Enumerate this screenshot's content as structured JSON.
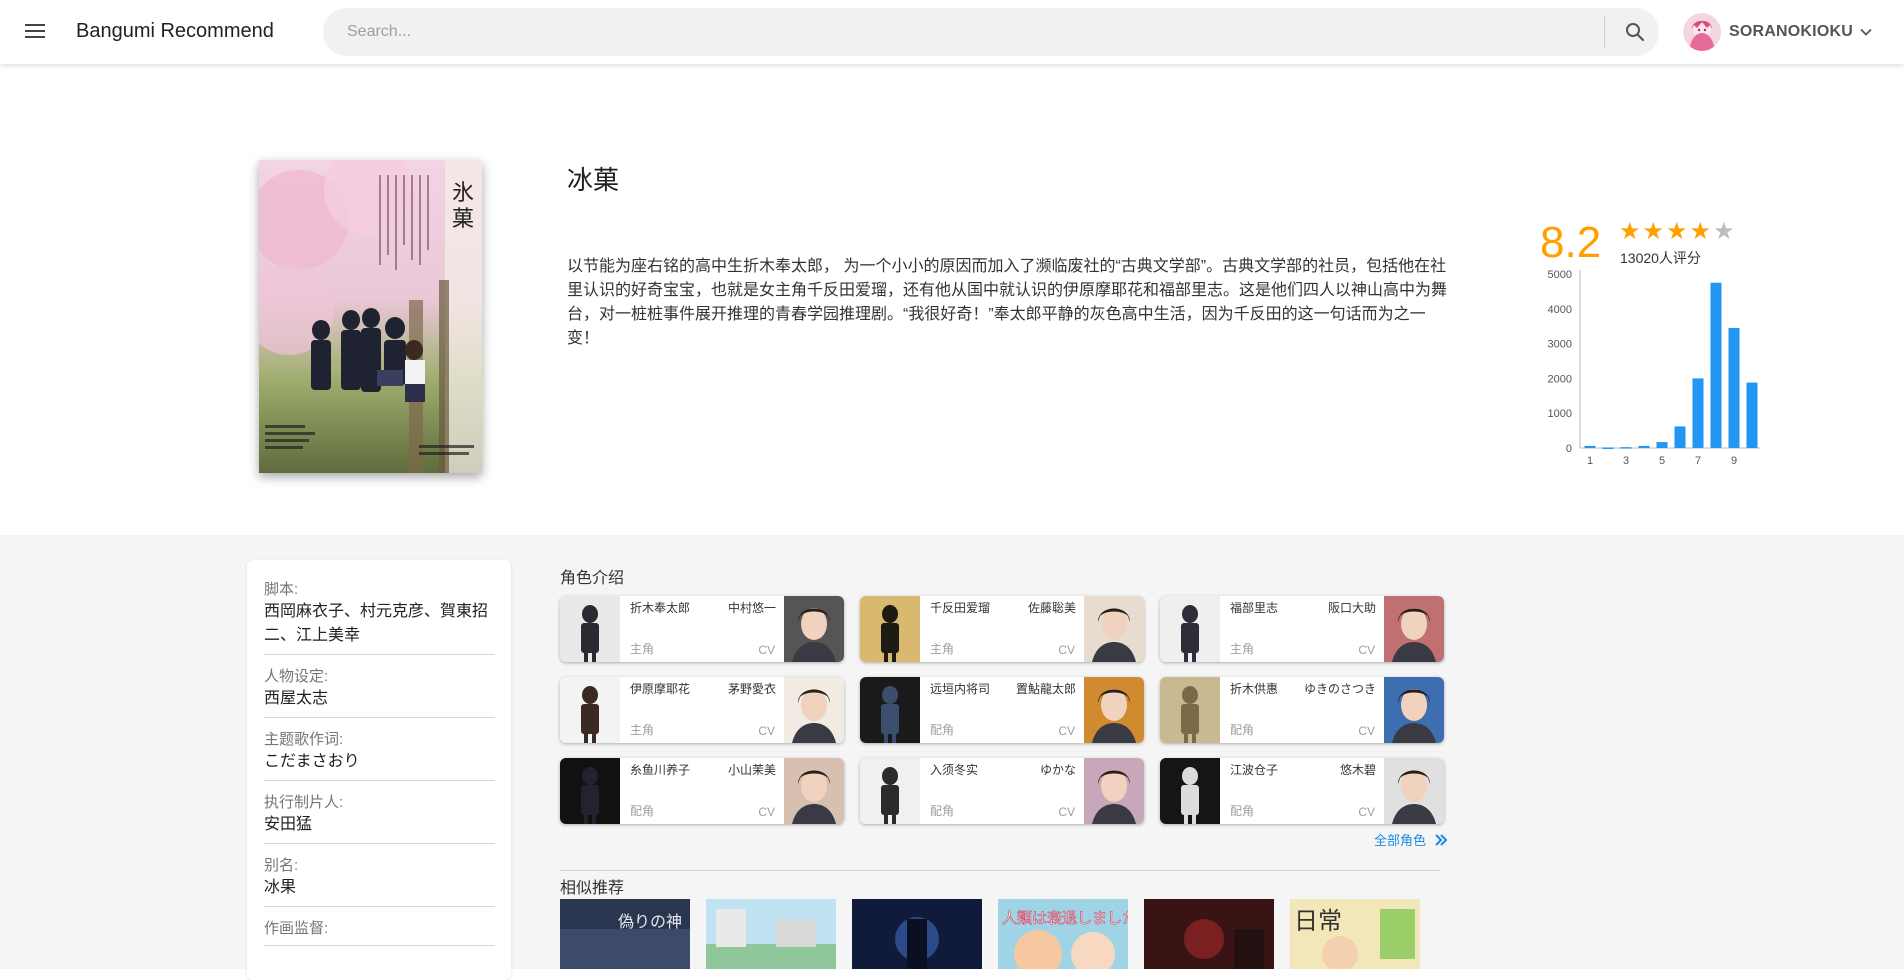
{
  "app": {
    "title": "Bangumi Recommend"
  },
  "search": {
    "placeholder": "Search..."
  },
  "user": {
    "name": "SORANOKIOKU"
  },
  "anime": {
    "title": "冰菓",
    "summary": "以节能为座右铭的高中生折木奉太郎， 为一个小小的原因而加入了濒临废社的“古典文学部”。古典文学部的社员，包括他在社里认识的好奇宝宝，也就是女主角千反田爱瑠，还有他从国中就认识的伊原摩耶花和福部里志。这是他们四人以神山高中为舞台，对一桩桩事件展开推理的青春学园推理剧。“我很好奇！”奉太郎平静的灰色高中生活，因为千反田的这一句话而为之一变！",
    "poster_text": [
      "氷",
      "菓"
    ]
  },
  "rating": {
    "score": "8.2",
    "stars": [
      "★",
      "★",
      "★",
      "★",
      "★"
    ],
    "stars_filled": 4,
    "votes": "13020人评分"
  },
  "chart_data": {
    "type": "bar",
    "categories": [
      1,
      2,
      3,
      4,
      5,
      6,
      7,
      8,
      9,
      10
    ],
    "x_tick_labels": [
      "1",
      "3",
      "5",
      "7",
      "9"
    ],
    "values": [
      60,
      15,
      25,
      60,
      170,
      620,
      2000,
      4750,
      3450,
      1880
    ],
    "y_tick_labels": [
      "5000",
      "4000",
      "3000",
      "2000",
      "1000",
      "0"
    ],
    "ylim": [
      0,
      5000
    ],
    "grid": false,
    "color": "#2196f3"
  },
  "info": [
    {
      "label": "脚本:",
      "value": "西岡麻衣子、村元克彦、賀東招二、江上美幸"
    },
    {
      "label": "人物设定:",
      "value": "西屋太志"
    },
    {
      "label": "主题歌作词:",
      "value": "こだまさおり"
    },
    {
      "label": "执行制片人:",
      "value": "安田猛"
    },
    {
      "label": "别名:",
      "value": "冰果"
    },
    {
      "label": "作画监督:",
      "value": ""
    }
  ],
  "characters_section": {
    "title": "角色介绍",
    "all_label": "全部角色"
  },
  "characters": [
    {
      "name": "折木奉太郎",
      "cv": "中村悠一",
      "role": "主角",
      "cv_label": "CV"
    },
    {
      "name": "千反田爱瑠",
      "cv": "佐藤聡美",
      "role": "主角",
      "cv_label": "CV"
    },
    {
      "name": "福部里志",
      "cv": "阪口大助",
      "role": "主角",
      "cv_label": "CV"
    },
    {
      "name": "伊原摩耶花",
      "cv": "茅野愛衣",
      "role": "主角",
      "cv_label": "CV"
    },
    {
      "name": "远垣内将司",
      "cv": "置鮎龍太郎",
      "role": "配角",
      "cv_label": "CV"
    },
    {
      "name": "折木供惠",
      "cv": "ゆきのさつき",
      "role": "配角",
      "cv_label": "CV"
    },
    {
      "name": "糸鱼川养子",
      "cv": "小山茉美",
      "role": "配角",
      "cv_label": "CV"
    },
    {
      "name": "入须冬实",
      "cv": "ゆかな",
      "role": "配角",
      "cv_label": "CV"
    },
    {
      "name": "江波仓子",
      "cv": "悠木碧",
      "role": "配角",
      "cv_label": "CV"
    }
  ],
  "similar": {
    "title": "相似推荐",
    "cover_texts": [
      "偽りの神",
      "",
      "",
      "人類は衰退しました",
      "",
      "日常"
    ]
  }
}
